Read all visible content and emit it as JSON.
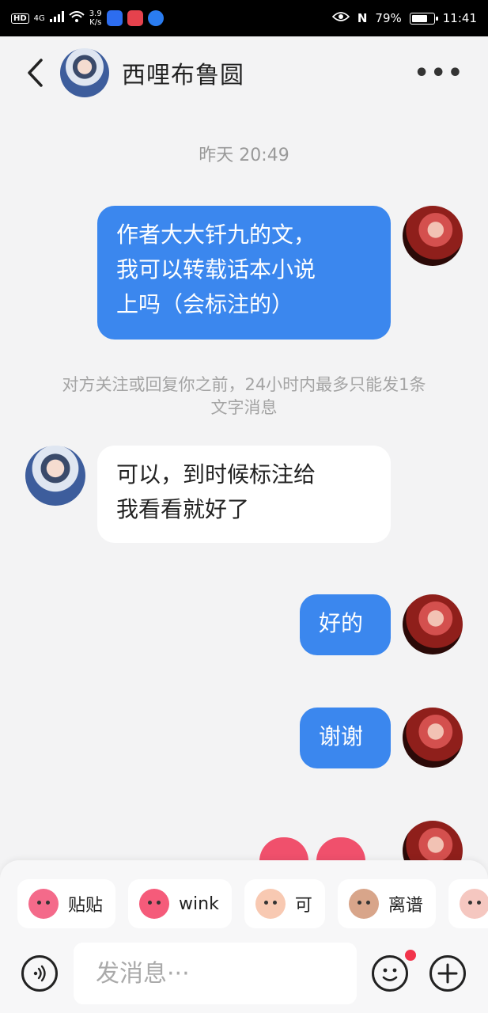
{
  "status_bar": {
    "hd": "HD",
    "net": "4G",
    "speed_value": "3.9",
    "speed_unit": "K/s",
    "battery": "79%",
    "battery_level": 0.79,
    "time": "11:41"
  },
  "header": {
    "contact_name": "西哩布鲁圆"
  },
  "chat": {
    "timestamp": "昨天 20:49",
    "notice": "对方关注或回复你之前，24小时内最多只能发1条文字消息",
    "messages": [
      {
        "from": "me",
        "lines": [
          "作者大大钎九的文，",
          "我可以转载话本小说",
          "上吗（会标注的）"
        ]
      },
      {
        "from": "contact",
        "lines": [
          "可以，到时候标注给",
          "我看看就好了"
        ]
      },
      {
        "from": "me",
        "lines": [
          "好的"
        ]
      },
      {
        "from": "me",
        "lines": [
          "谢谢"
        ]
      }
    ]
  },
  "quick_replies": [
    {
      "label": "贴贴",
      "color": "#f46a8a"
    },
    {
      "label": "wink",
      "color": "#f55b7a"
    },
    {
      "label": "可",
      "color": "#f8c9b2"
    },
    {
      "label": "离谱",
      "color": "#d8a58a"
    },
    {
      "label": "",
      "color": "#f5c7c0"
    }
  ],
  "input": {
    "placeholder": "发消息···"
  },
  "colors": {
    "bubble_out": "#3b87ee",
    "bubble_in": "#ffffff",
    "notification_dot": "#f2344b"
  }
}
